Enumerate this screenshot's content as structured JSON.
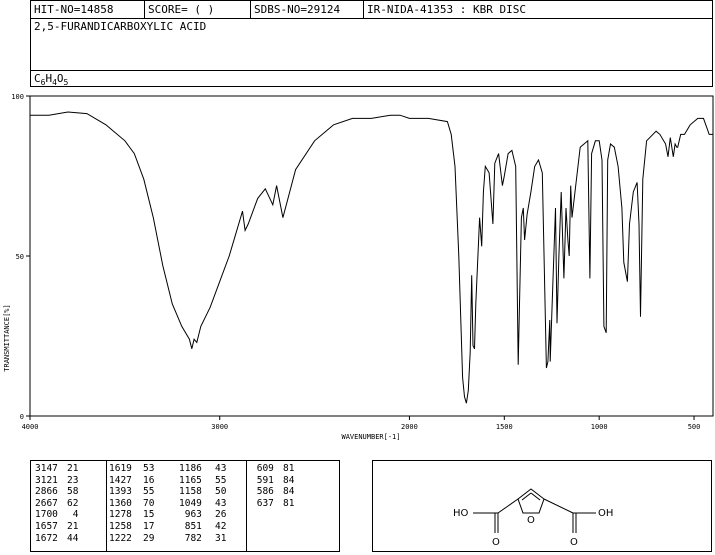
{
  "header": {
    "hit_no": "HIT-NO=14858",
    "score": "SCORE=  (   )",
    "sdbs_no": "SDBS-NO=29124",
    "ir_nida": "IR-NIDA-41353 : KBR DISC",
    "compound_name": "2,5-FURANDICARBOXYLIC ACID",
    "formula": {
      "c": "C",
      "c_n": "6",
      "h": "H",
      "h_n": "4",
      "o": "O",
      "o_n": "5"
    }
  },
  "chart_data": {
    "type": "line",
    "xlabel": "WAVENUMBER[-1]",
    "ylabel": "TRANSMITTANCE[%]",
    "xlim": [
      4000,
      400
    ],
    "ylim": [
      0,
      100
    ],
    "x_ticks": [
      4000,
      3000,
      2000,
      1500,
      1000,
      500
    ],
    "y_ticks": [
      0,
      50,
      100
    ],
    "grid": false,
    "series": [
      {
        "color": "#000000",
        "points": [
          [
            4000,
            94
          ],
          [
            3900,
            94
          ],
          [
            3800,
            95
          ],
          [
            3700,
            94.5
          ],
          [
            3600,
            91
          ],
          [
            3500,
            86
          ],
          [
            3450,
            82
          ],
          [
            3400,
            74
          ],
          [
            3350,
            62
          ],
          [
            3300,
            47
          ],
          [
            3250,
            35
          ],
          [
            3200,
            28
          ],
          [
            3160,
            24
          ],
          [
            3147,
            21
          ],
          [
            3135,
            24
          ],
          [
            3121,
            23
          ],
          [
            3100,
            28
          ],
          [
            3050,
            34
          ],
          [
            3000,
            42
          ],
          [
            2950,
            50
          ],
          [
            2920,
            56
          ],
          [
            2900,
            60
          ],
          [
            2880,
            64
          ],
          [
            2866,
            58
          ],
          [
            2850,
            60
          ],
          [
            2800,
            68
          ],
          [
            2760,
            71
          ],
          [
            2720,
            66
          ],
          [
            2700,
            72
          ],
          [
            2667,
            62
          ],
          [
            2640,
            68
          ],
          [
            2600,
            77
          ],
          [
            2500,
            86
          ],
          [
            2400,
            91
          ],
          [
            2300,
            93
          ],
          [
            2200,
            93
          ],
          [
            2100,
            94
          ],
          [
            2050,
            94
          ],
          [
            2000,
            93
          ],
          [
            1900,
            93
          ],
          [
            1800,
            92
          ],
          [
            1780,
            88
          ],
          [
            1760,
            78
          ],
          [
            1740,
            50
          ],
          [
            1720,
            12
          ],
          [
            1710,
            6
          ],
          [
            1700,
            4
          ],
          [
            1690,
            8
          ],
          [
            1680,
            20
          ],
          [
            1672,
            44
          ],
          [
            1665,
            22
          ],
          [
            1657,
            21
          ],
          [
            1650,
            35
          ],
          [
            1630,
            62
          ],
          [
            1619,
            53
          ],
          [
            1610,
            70
          ],
          [
            1600,
            78
          ],
          [
            1580,
            76
          ],
          [
            1560,
            60
          ],
          [
            1550,
            79
          ],
          [
            1530,
            82
          ],
          [
            1510,
            72
          ],
          [
            1500,
            75
          ],
          [
            1480,
            82
          ],
          [
            1460,
            83
          ],
          [
            1440,
            78
          ],
          [
            1427,
            16
          ],
          [
            1420,
            35
          ],
          [
            1410,
            62
          ],
          [
            1400,
            65
          ],
          [
            1393,
            55
          ],
          [
            1380,
            63
          ],
          [
            1360,
            70
          ],
          [
            1340,
            78
          ],
          [
            1320,
            80
          ],
          [
            1300,
            76
          ],
          [
            1278,
            15
          ],
          [
            1270,
            17
          ],
          [
            1260,
            30
          ],
          [
            1258,
            17
          ],
          [
            1245,
            40
          ],
          [
            1230,
            65
          ],
          [
            1222,
            29
          ],
          [
            1212,
            50
          ],
          [
            1200,
            70
          ],
          [
            1186,
            43
          ],
          [
            1175,
            65
          ],
          [
            1165,
            55
          ],
          [
            1158,
            50
          ],
          [
            1150,
            72
          ],
          [
            1143,
            62
          ],
          [
            1100,
            84
          ],
          [
            1060,
            86
          ],
          [
            1049,
            43
          ],
          [
            1040,
            82
          ],
          [
            1020,
            86
          ],
          [
            1000,
            86
          ],
          [
            985,
            80
          ],
          [
            975,
            28
          ],
          [
            963,
            26
          ],
          [
            955,
            80
          ],
          [
            940,
            85
          ],
          [
            920,
            84
          ],
          [
            900,
            78
          ],
          [
            880,
            65
          ],
          [
            870,
            48
          ],
          [
            851,
            42
          ],
          [
            840,
            60
          ],
          [
            820,
            70
          ],
          [
            800,
            73
          ],
          [
            790,
            60
          ],
          [
            782,
            31
          ],
          [
            770,
            74
          ],
          [
            750,
            86
          ],
          [
            700,
            89
          ],
          [
            680,
            88
          ],
          [
            650,
            85
          ],
          [
            637,
            81
          ],
          [
            625,
            87
          ],
          [
            609,
            81
          ],
          [
            600,
            85
          ],
          [
            591,
            84
          ],
          [
            586,
            84
          ],
          [
            570,
            88
          ],
          [
            550,
            88
          ],
          [
            520,
            91
          ],
          [
            480,
            93
          ],
          [
            450,
            93
          ],
          [
            420,
            88
          ],
          [
            400,
            88
          ]
        ]
      }
    ]
  },
  "peaks": [
    {
      "wn": "3147",
      "t": "21"
    },
    {
      "wn": "3121",
      "t": "23"
    },
    {
      "wn": "2866",
      "t": "58"
    },
    {
      "wn": "2667",
      "t": "62"
    },
    {
      "wn": "1700",
      "t": "4"
    },
    {
      "wn": "1657",
      "t": "21"
    },
    {
      "wn": "1672",
      "t": "44"
    },
    {
      "wn": "1619",
      "t": "53"
    },
    {
      "wn": "1427",
      "t": "16"
    },
    {
      "wn": "1393",
      "t": "55"
    },
    {
      "wn": "1360",
      "t": "70"
    },
    {
      "wn": "1278",
      "t": "15"
    },
    {
      "wn": "1258",
      "t": "17"
    },
    {
      "wn": "1222",
      "t": "29"
    },
    {
      "wn": "1186",
      "t": "43"
    },
    {
      "wn": "1165",
      "t": "55"
    },
    {
      "wn": "1158",
      "t": "50"
    },
    {
      "wn": "1049",
      "t": "43"
    },
    {
      "wn": "963",
      "t": "26"
    },
    {
      "wn": "851",
      "t": "42"
    },
    {
      "wn": "782",
      "t": "31"
    },
    {
      "wn": "609",
      "t": "81"
    },
    {
      "wn": "591",
      "t": "84"
    },
    {
      "wn": "586",
      "t": "84"
    },
    {
      "wn": "637",
      "t": "81"
    }
  ],
  "structure": {
    "left_group": "HO",
    "right_group": "OH",
    "ring_o": "O",
    "carbonyl_o": "O"
  }
}
